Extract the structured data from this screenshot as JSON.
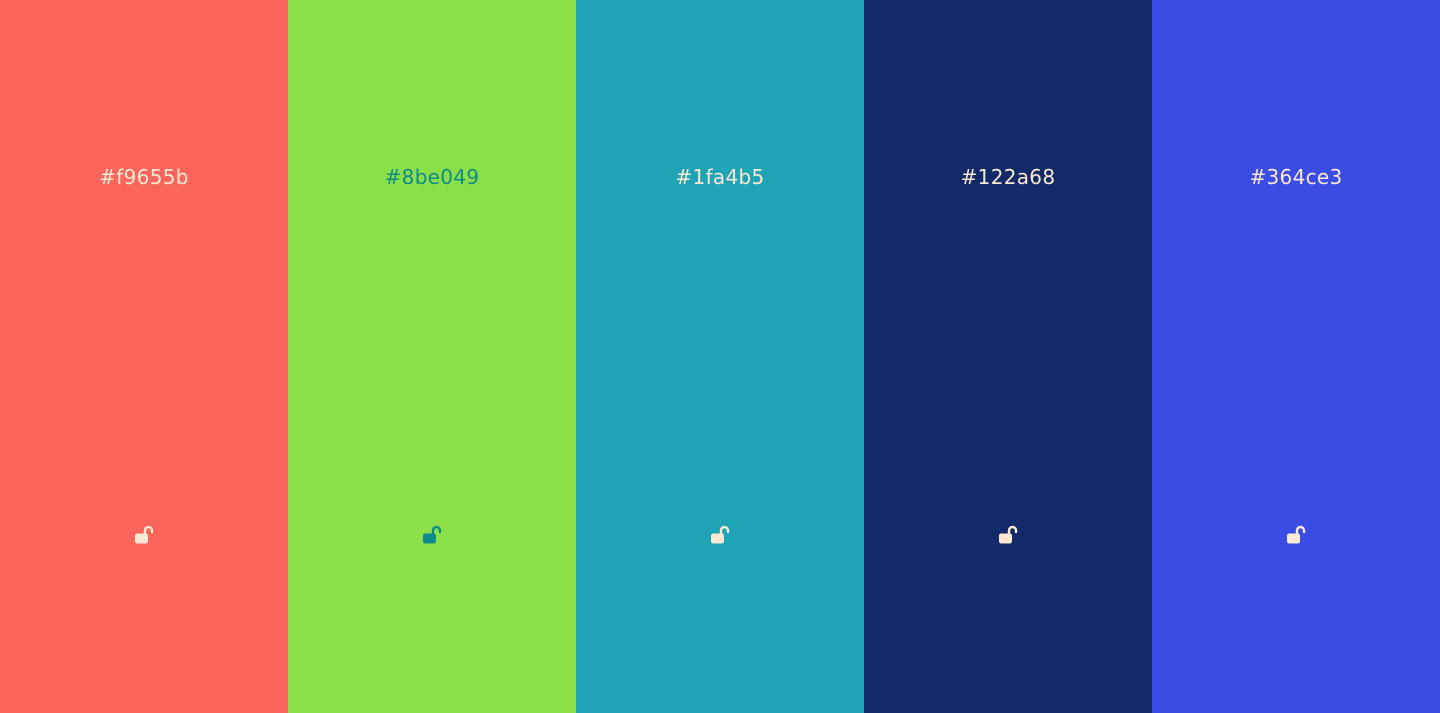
{
  "palette": {
    "swatches": [
      {
        "hex": "#f9655b",
        "background": "#f9655b",
        "text_color": "#fbe9d3",
        "lock_icon": "unlock-icon",
        "locked": false
      },
      {
        "hex": "#8be049",
        "background": "#8be049",
        "text_color": "#0e8a8a",
        "lock_icon": "unlock-icon",
        "locked": false
      },
      {
        "hex": "#1fa4b5",
        "background": "#1fa4b5",
        "text_color": "#fbe9d3",
        "lock_icon": "unlock-icon",
        "locked": false
      },
      {
        "hex": "#122a68",
        "background": "#122a68",
        "text_color": "#fbe9d3",
        "lock_icon": "unlock-icon",
        "locked": false
      },
      {
        "hex": "#364ce3",
        "background": "#3a4ce3",
        "text_color": "#fbe9d3",
        "lock_icon": "unlock-icon",
        "locked": false
      }
    ]
  }
}
